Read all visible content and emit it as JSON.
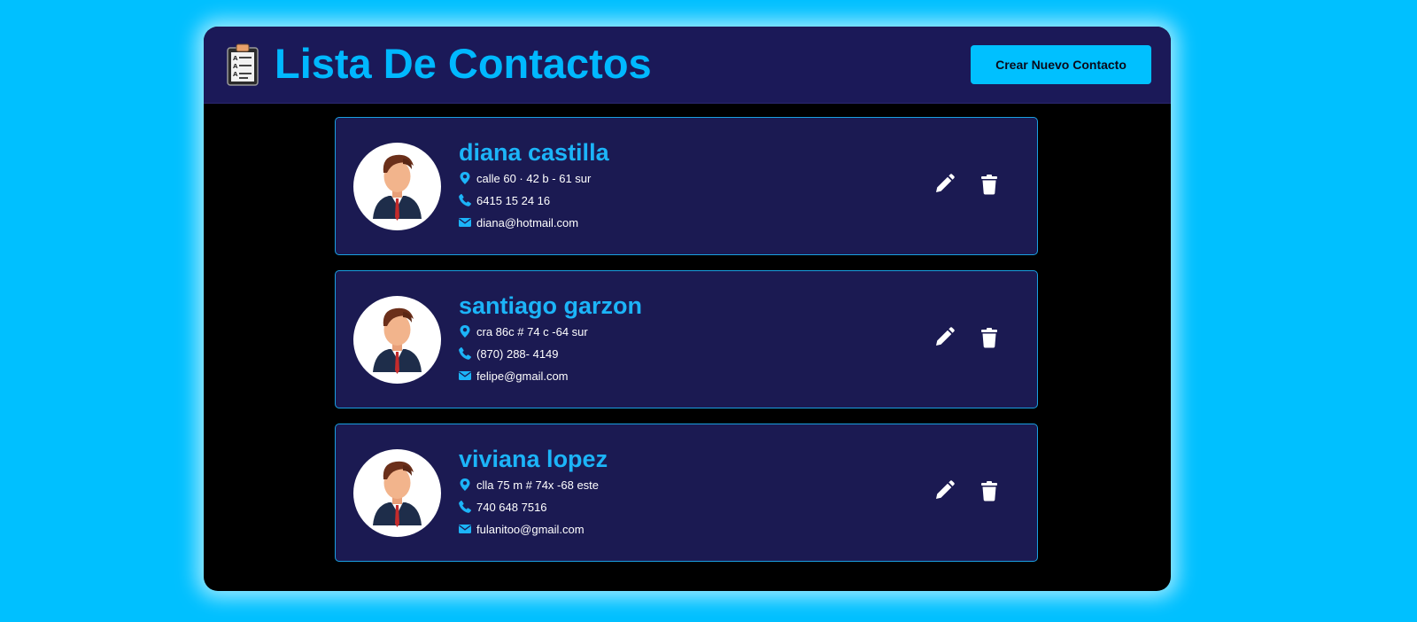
{
  "header": {
    "title": "Lista De Contactos",
    "create_button_label": "Crear Nuevo Contacto",
    "icon": "clipboard-icon"
  },
  "colors": {
    "page_background": "#00c0ff",
    "header_background": "#1b1958",
    "card_background": "#1b1a52",
    "accent": "#1cb4f8",
    "card_border": "#1a9fe0"
  },
  "contacts": [
    {
      "name": "diana castilla",
      "address": "calle 60 · 42 b - 61 sur",
      "phone": "6415 15 24 16",
      "email": "diana@hotmail.com"
    },
    {
      "name": "santiago garzon",
      "address": "cra 86c # 74 c -64 sur",
      "phone": "(870) 288- 4149",
      "email": "felipe@gmail.com"
    },
    {
      "name": "viviana lopez",
      "address": "clla 75 m # 74x -68 este",
      "phone": "740 648 7516",
      "email": "fulanitoo@gmail.com"
    }
  ],
  "icons": {
    "address": "map-marker-icon",
    "phone": "phone-icon",
    "email": "envelope-icon",
    "edit": "pencil-icon",
    "delete": "trash-icon",
    "avatar": "businessman-avatar"
  }
}
